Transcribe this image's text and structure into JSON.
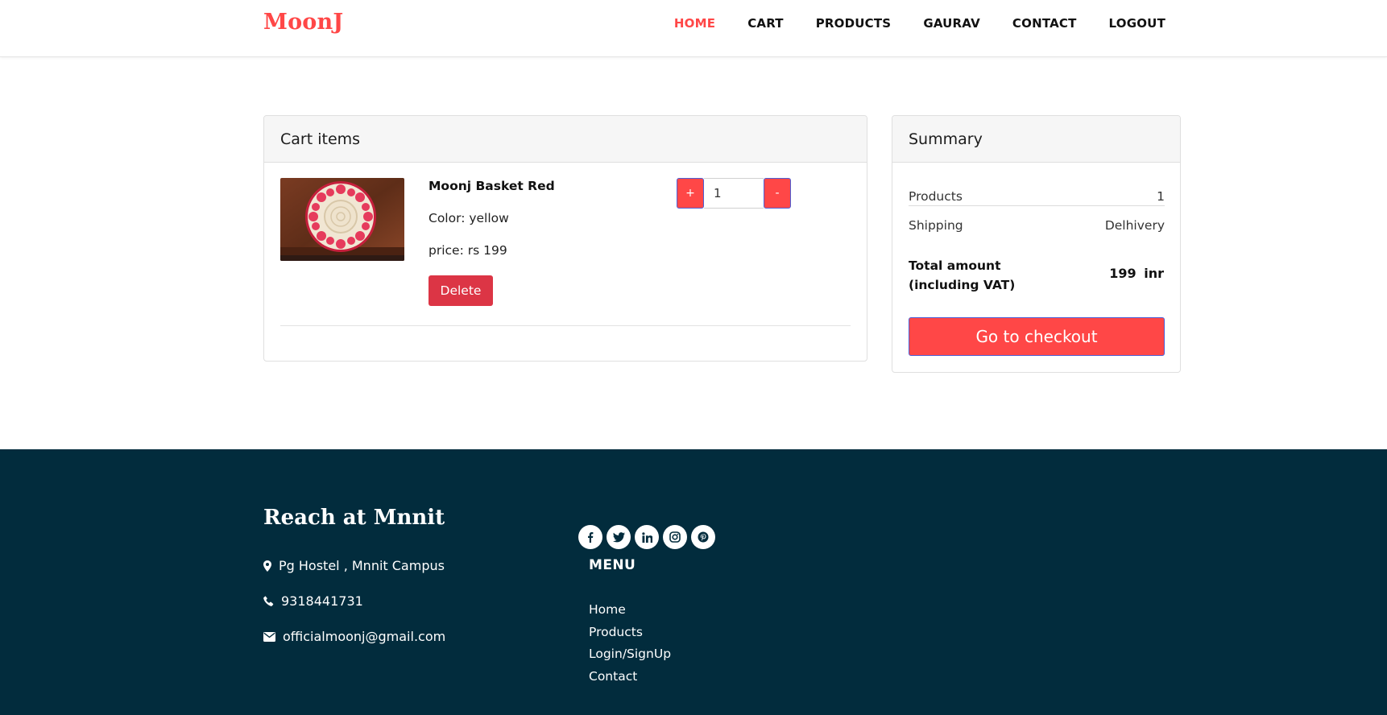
{
  "brand": "MoonJ",
  "nav": {
    "items": [
      {
        "label": "HOME",
        "active": true
      },
      {
        "label": "CART",
        "active": false
      },
      {
        "label": "PRODUCTS",
        "active": false
      },
      {
        "label": "GAURAV",
        "active": false
      },
      {
        "label": "CONTACT",
        "active": false
      },
      {
        "label": "LOGOUT",
        "active": false
      }
    ]
  },
  "cart": {
    "title": "Cart items",
    "item": {
      "name": "Moonj Basket Red",
      "color": "Color: yellow",
      "price": "price: rs 199",
      "delete_label": "Delete",
      "quantity": "1",
      "plus_label": "+",
      "minus_label": "-"
    }
  },
  "summary": {
    "title": "Summary",
    "products_label": "Products",
    "products_value": "1",
    "shipping_label": "Shipping",
    "shipping_value": "Delhivery",
    "total_label_line1": "Total amount",
    "total_label_line2": "(including VAT)",
    "total_value": "199 inr",
    "checkout_label": "Go to checkout"
  },
  "footer": {
    "title": "Reach at Mnnit",
    "address": "Pg Hostel , Mnnit Campus",
    "phone": "9318441731",
    "email": "officialmoonj@gmail.com",
    "socials": [
      "facebook-icon",
      "twitter-icon",
      "linkedin-icon",
      "instagram-icon",
      "pinterest-icon"
    ],
    "menu_title": "MENU",
    "menu": [
      "Home",
      "Products",
      "Login/SignUp",
      "Contact"
    ]
  },
  "colors": {
    "accent": "#ff4747",
    "danger": "#dc3545",
    "footer_bg": "#022c3d"
  }
}
